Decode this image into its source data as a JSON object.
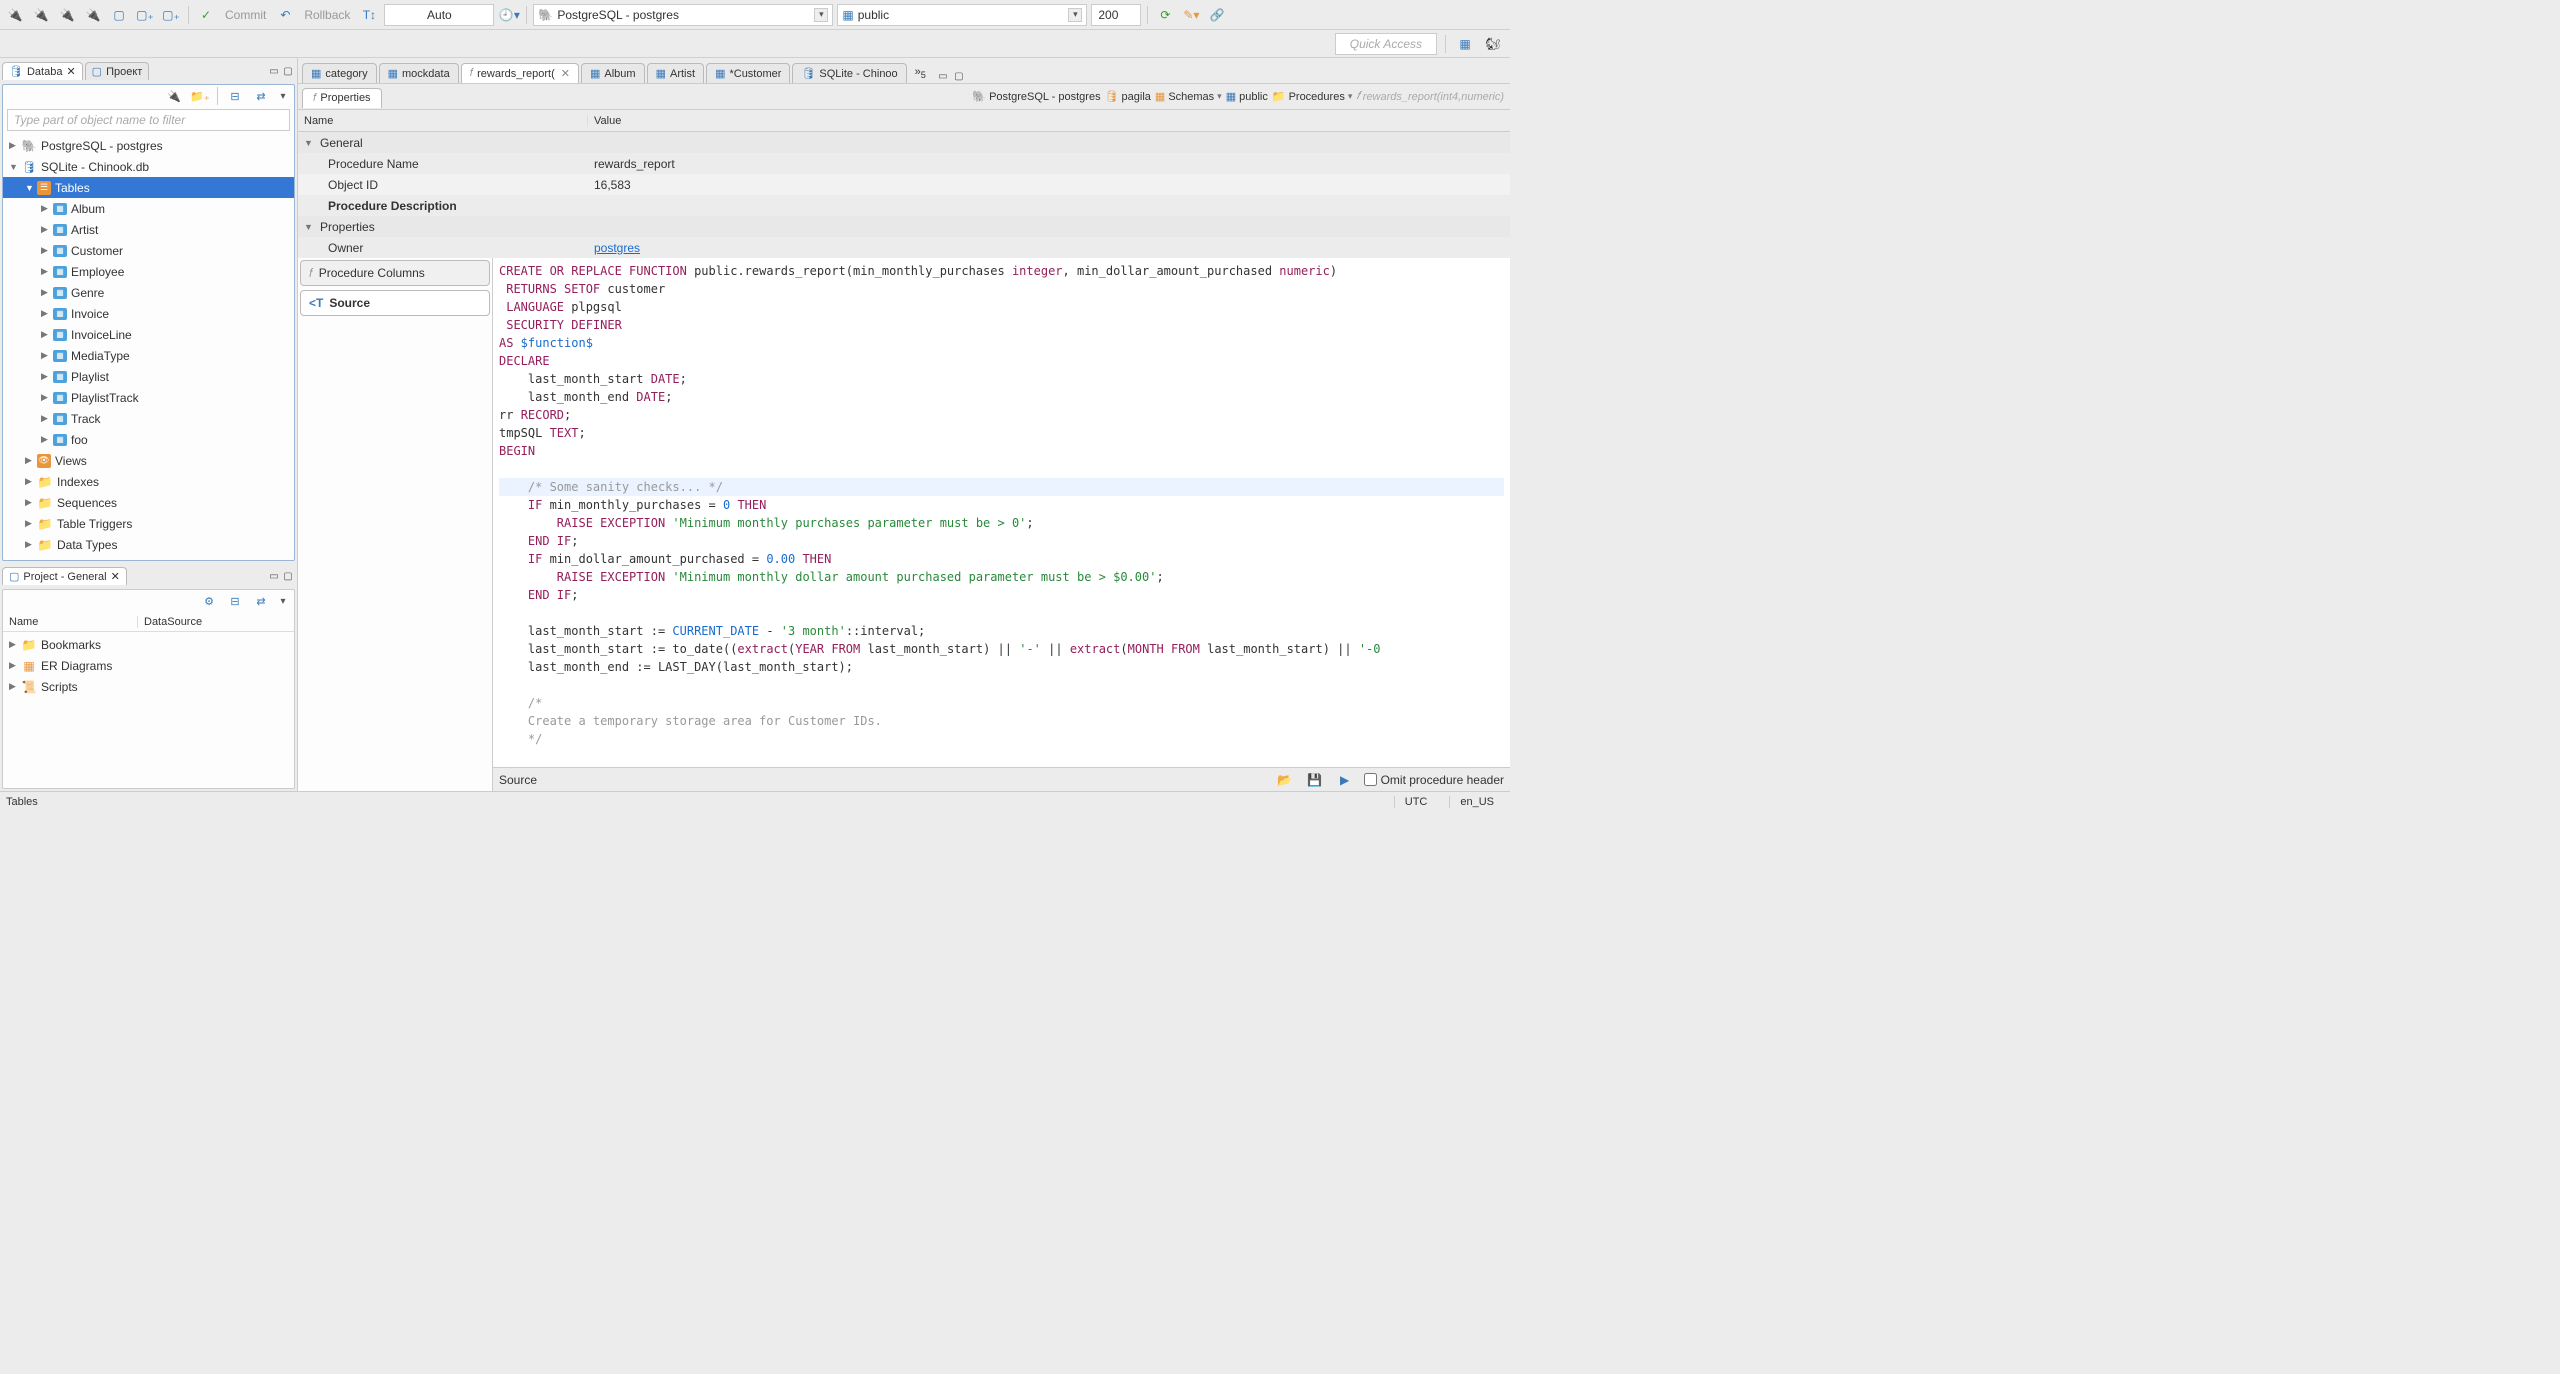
{
  "toolbar": {
    "commit": "Commit",
    "rollback": "Rollback",
    "auto": "Auto",
    "datasource": "PostgreSQL - postgres",
    "schema": "public",
    "limit": "200",
    "quick_access": "Quick Access"
  },
  "db_panel": {
    "tab1": "Databa",
    "tab2": "Проект",
    "filter_placeholder": "Type part of object name to filter",
    "nodes": {
      "pg": "PostgreSQL - postgres",
      "sqlite": "SQLite - Chinook.db",
      "tables": "Tables",
      "album": "Album",
      "artist": "Artist",
      "customer": "Customer",
      "employee": "Employee",
      "genre": "Genre",
      "invoice": "Invoice",
      "invoiceline": "InvoiceLine",
      "mediatype": "MediaType",
      "playlist": "Playlist",
      "playlisttrack": "PlaylistTrack",
      "track": "Track",
      "foo": "foo",
      "views": "Views",
      "indexes": "Indexes",
      "sequences": "Sequences",
      "triggers": "Table Triggers",
      "datatypes": "Data Types"
    }
  },
  "project_panel": {
    "title": "Project - General",
    "col_name": "Name",
    "col_ds": "DataSource",
    "bookmarks": "Bookmarks",
    "er": "ER Diagrams",
    "scripts": "Scripts"
  },
  "editor_tabs": {
    "category": "category",
    "mockdata": "mockdata",
    "rewards": "rewards_report(",
    "album": "Album",
    "artist": "Artist",
    "customer": "*Customer",
    "sqlite": "SQLite - Chinoo",
    "more": "»",
    "more_count": "5"
  },
  "side_tabs": {
    "properties": "Properties"
  },
  "breadcrumbs": {
    "pg": "PostgreSQL - postgres",
    "pagila": "pagila",
    "schemas": "Schemas",
    "public": "public",
    "procedures": "Procedures",
    "func": "rewards_report(int4,numeric)"
  },
  "prop_table": {
    "h_name": "Name",
    "h_value": "Value",
    "general": "General",
    "proc_name_k": "Procedure Name",
    "proc_name_v": "rewards_report",
    "obj_id_k": "Object ID",
    "obj_id_v": "16,583",
    "proc_desc_k": "Procedure Description",
    "properties": "Properties",
    "owner_k": "Owner",
    "owner_v": "postgres"
  },
  "side_list": {
    "columns": "Procedure Columns",
    "source": "Source"
  },
  "footer": {
    "source": "Source",
    "omit": "Omit procedure header"
  },
  "status": {
    "tables": "Tables",
    "utc": "UTC",
    "locale": "en_US"
  },
  "code": {
    "l1a": "CREATE OR REPLACE FUNCTION",
    "l1b": " public.rewards_report(min_monthly_purchases ",
    "l1c": "integer",
    "l1d": ", min_dollar_amount_purchased ",
    "l1e": "numeric",
    "l1f": ")",
    "l2a": " RETURNS SETOF",
    "l2b": " customer",
    "l3a": " LANGUAGE",
    "l3b": " plpgsql",
    "l4": " SECURITY DEFINER",
    "l5a": "AS",
    "l5b": " $function$",
    "l6": "DECLARE",
    "l7a": "    last_month_start ",
    "l7b": "DATE",
    "l7c": ";",
    "l8a": "    last_month_end ",
    "l8b": "DATE",
    "l8c": ";",
    "l9a": "rr ",
    "l9b": "RECORD",
    "l9c": ";",
    "l10a": "tmpSQL ",
    "l10b": "TEXT",
    "l10c": ";",
    "l11": "BEGIN",
    "l12": "",
    "l13": "    /* Some sanity checks... */",
    "l14a": "    IF",
    "l14b": " min_monthly_purchases = ",
    "l14c": "0",
    "l14d": " THEN",
    "l15a": "        RAISE EXCEPTION",
    "l15b": " 'Minimum monthly purchases parameter must be > 0'",
    "l15c": ";",
    "l16a": "    END",
    "l16b": " IF",
    "l16c": ";",
    "l17a": "    IF",
    "l17b": " min_dollar_amount_purchased = ",
    "l17c": "0.00",
    "l17d": " THEN",
    "l18a": "        RAISE EXCEPTION",
    "l18b": " 'Minimum monthly dollar amount purchased parameter must be > $0.00'",
    "l18c": ";",
    "l19a": "    END",
    "l19b": " IF",
    "l19c": ";",
    "l20": "",
    "l21a": "    last_month_start := ",
    "l21b": "CURRENT_DATE",
    "l21c": " - ",
    "l21d": "'3 month'",
    "l21e": "::interval;",
    "l22a": "    last_month_start := to_date((",
    "l22b": "extract",
    "l22c": "(",
    "l22d": "YEAR FROM",
    "l22e": " last_month_start) || ",
    "l22f": "'-'",
    "l22g": " || ",
    "l22h": "extract",
    "l22i": "(",
    "l22j": "MONTH FROM",
    "l22k": " last_month_start) || ",
    "l22l": "'-0",
    "l23": "    last_month_end := LAST_DAY(last_month_start);",
    "l24": "",
    "l25": "    /*",
    "l26": "    Create a temporary storage area for Customer IDs.",
    "l27": "    */"
  }
}
